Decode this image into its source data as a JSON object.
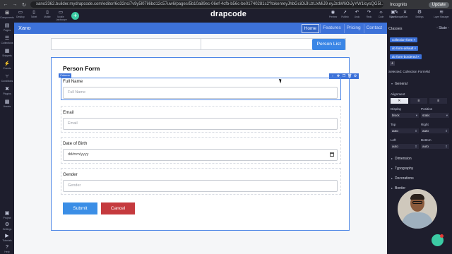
{
  "browser": {
    "url": "xano3362.builder.mydrapcode.com/editor/6o32nci7v9y5l07il6bd12c57uw6/pages/5b10a89ec-06ef-4cfb-b56c-be01740281c2?tokenreyJhbGciOiJIUzUxMiJ9.eyJzdWIiOiJyYW1lcysQG5l...",
    "mode": "Incognito",
    "update_label": "Update"
  },
  "left_sidebar": {
    "items": [
      {
        "icon": "plus-square-icon",
        "label": "Components"
      },
      {
        "icon": "file-icon",
        "label": "Pages"
      },
      {
        "icon": "database-icon",
        "label": "Collections"
      },
      {
        "icon": "grid-icon",
        "label": "Snippets"
      },
      {
        "icon": "bolt-icon",
        "label": "Events"
      },
      {
        "icon": "branch-icon",
        "label": "Conditions"
      },
      {
        "icon": "plug-icon",
        "label": "Plugins"
      },
      {
        "icon": "image-icon",
        "label": "Assets"
      }
    ],
    "bottom_items": [
      {
        "icon": "project-icon",
        "label": "Project"
      },
      {
        "icon": "settings-icon",
        "label": "Settings"
      },
      {
        "icon": "tutorials-icon",
        "label": "Tutorials"
      },
      {
        "icon": "help-icon",
        "label": "Help"
      }
    ]
  },
  "top_toolbar": {
    "devices": [
      {
        "icon": "desktop-icon",
        "label": "Desktop"
      },
      {
        "icon": "tablet-icon",
        "label": "Tablet"
      },
      {
        "icon": "mobile-icon",
        "label": "Mobile"
      },
      {
        "icon": "mobile-landscape-icon",
        "label": "Mobile Landscape"
      }
    ],
    "logo": "drapcode",
    "actions": [
      {
        "icon": "preview-icon",
        "label": "Preview"
      },
      {
        "icon": "publish-icon",
        "label": "Publish"
      },
      {
        "icon": "undo-icon",
        "label": "Undo"
      },
      {
        "icon": "redo-icon",
        "label": "Redo"
      },
      {
        "icon": "code-icon",
        "label": "Code"
      },
      {
        "icon": "save-icon",
        "label": "Save"
      },
      {
        "icon": "clear-icon",
        "label": "Clear"
      }
    ],
    "managers": [
      {
        "icon": "brush-icon",
        "label": "Style Manager"
      },
      {
        "icon": "gear-icon",
        "label": "Settings"
      },
      {
        "icon": "layers-icon",
        "label": "Layer Manager"
      }
    ]
  },
  "site": {
    "brand": "Xano",
    "nav": [
      "Home",
      "Features",
      "Pricing",
      "Contact"
    ],
    "active_nav": "Home",
    "person_list_button": "Person List"
  },
  "form": {
    "title": "Person Form",
    "column_tag": "Column",
    "fields": [
      {
        "label": "Full Name",
        "placeholder": "Full Name"
      },
      {
        "label": "Email",
        "placeholder": "Email"
      },
      {
        "label": "Date of Birth",
        "placeholder": "dd/mm/yyyy"
      },
      {
        "label": "Gender",
        "placeholder": "Gender"
      }
    ],
    "submit_label": "Submit",
    "cancel_label": "Cancel"
  },
  "style_panel": {
    "classes_header": "Classes",
    "state": "- State -",
    "classes": [
      "collection-form",
      "dc-form-default",
      "dc-form-bordered"
    ],
    "selected_text": "Selected: Collection Form#id",
    "sections": {
      "general": "General",
      "dimension": "Dimension",
      "typography": "Typography",
      "decorations": "Decorations",
      "border": "Border"
    },
    "alignment_label": "Alignment",
    "props": {
      "display_label": "Display",
      "display_value": "block",
      "position_label": "Position",
      "position_value": "static",
      "top_label": "Top",
      "top_value": "auto",
      "right_label": "Right",
      "right_value": "auto",
      "left_label": "Left",
      "left_value": "auto",
      "bottom_label": "Bottom",
      "bottom_value": "auto"
    }
  }
}
